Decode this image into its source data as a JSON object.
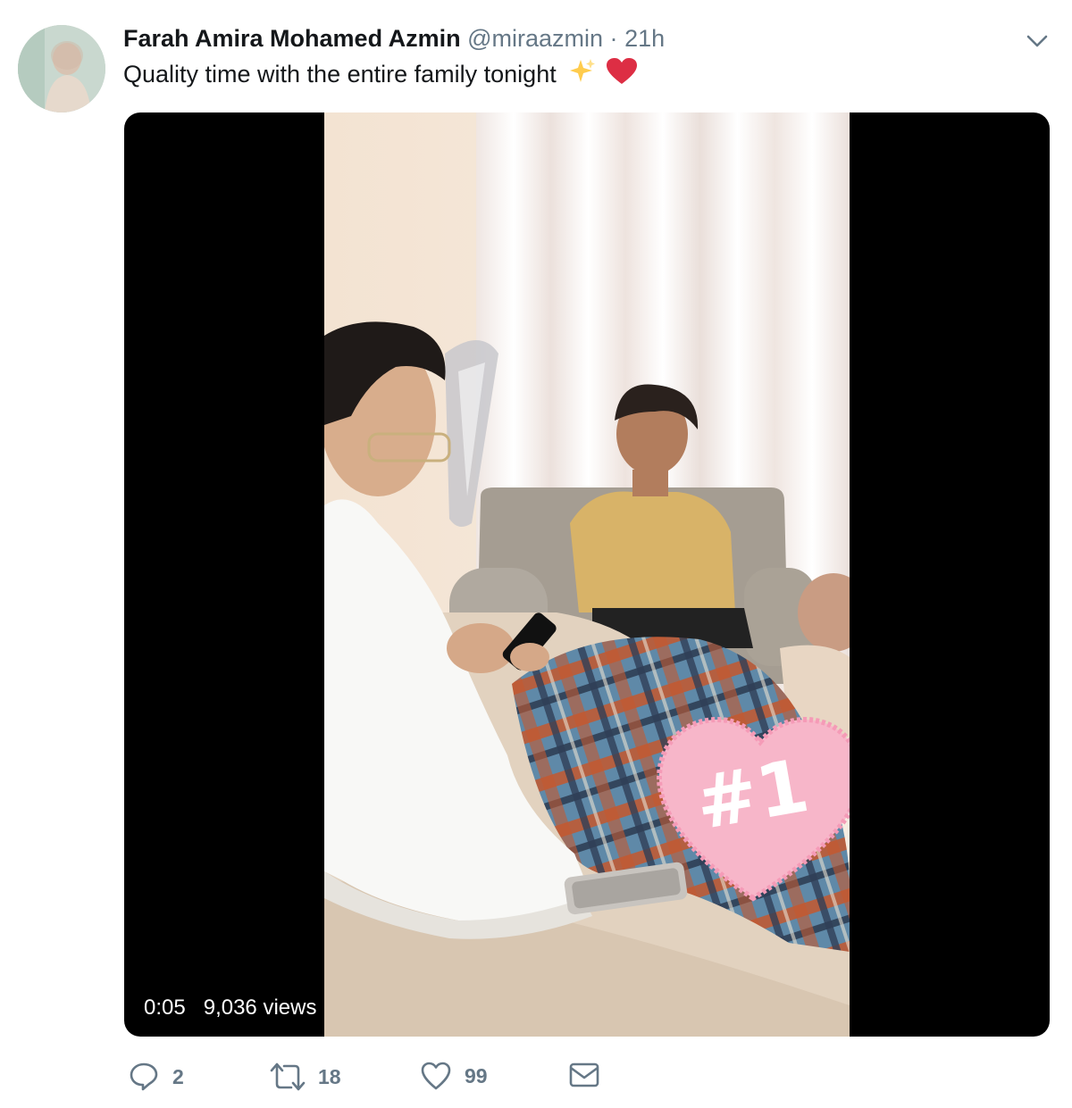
{
  "tweet": {
    "author_name": "Farah Amira Mohamed Azmin",
    "handle": "@miraazmin",
    "separator": "·",
    "time": "21h",
    "text": "Quality time with the entire family tonight",
    "emojis": [
      "sparkles-icon",
      "red-heart-icon"
    ]
  },
  "video": {
    "duration": "0:05",
    "views": "9,036 views",
    "sticker_text": "#1"
  },
  "actions": {
    "reply_count": "2",
    "retweet_count": "18",
    "like_count": "99"
  },
  "colors": {
    "text_primary": "#14171a",
    "text_secondary": "#657786",
    "heart_red": "#e0245e",
    "sticker_pink": "#f7b6c9"
  }
}
